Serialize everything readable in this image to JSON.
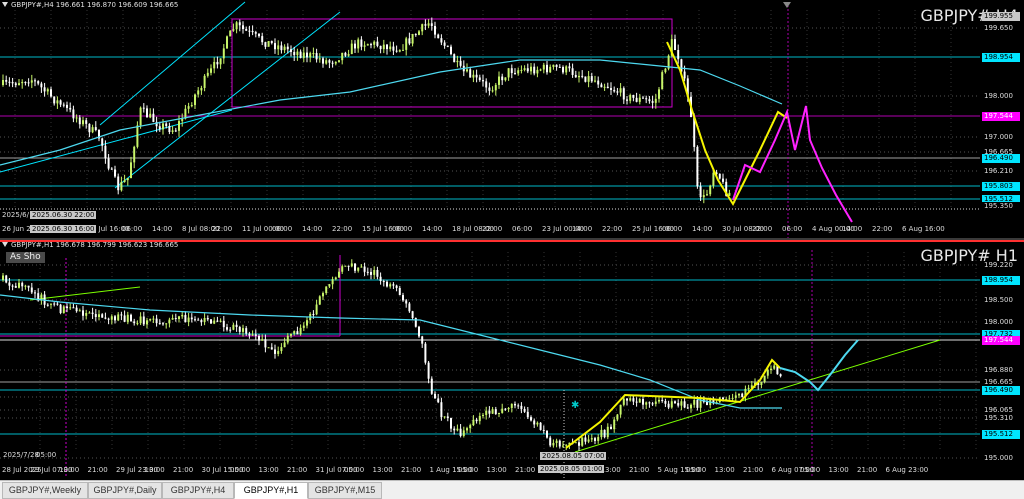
{
  "top": {
    "header": "GBPJPY#,H4  196.661 196.870 196.609 196.665",
    "watermark": "GBPJPY# H4",
    "price_labels": [
      {
        "text": "199.955",
        "style": "grey"
      },
      {
        "text": "199.650",
        "style": "plain"
      },
      {
        "text": "198.954",
        "style": "cyan"
      },
      {
        "text": "198.000",
        "style": "plain"
      },
      {
        "text": "197.544",
        "style": "mag"
      },
      {
        "text": "197.000",
        "style": "plain"
      },
      {
        "text": "196.665",
        "style": "plain"
      },
      {
        "text": "196.490",
        "style": "cyan"
      },
      {
        "text": "196.210",
        "style": "plain"
      },
      {
        "text": "195.803",
        "style": "cyan"
      },
      {
        "text": "195.512",
        "style": "cyan"
      },
      {
        "text": "195.350",
        "style": "plain"
      }
    ],
    "time_labels": [
      "26 Jun 2025",
      "14:00",
      "22:00",
      "3 Jul 16:00",
      "06:00",
      "14:00",
      "8 Jul 08:00",
      "22:00",
      "11 Jul 00:00",
      "06:00",
      "14:00",
      "22:00",
      "15 Jul 16:00",
      "06:00",
      "14:00",
      "18 Jul 08:00",
      "22:00",
      "06:00",
      "23 Jul 00:00",
      "14:00",
      "22:00",
      "25 Jul 16:00",
      "06:00",
      "14:00",
      "30 Jul 08:00",
      "22:00",
      "06:00",
      "4 Aug 00:00",
      "14:00",
      "22:00",
      "6 Aug 16:00"
    ],
    "cursor_time_left": "2025.06.30 22:00",
    "cursor_time_bottom": "2025.06.30 16:00",
    "left_edge_label": "2025/6/"
  },
  "bottom": {
    "header": "GBPJPY#,H1  196.678 196.799 196.623 196.665",
    "watermark": "GBPJPY# H1",
    "button": "As Sho",
    "price_labels": [
      {
        "text": "199.220",
        "style": "plain"
      },
      {
        "text": "198.954",
        "style": "cyan"
      },
      {
        "text": "198.500",
        "style": "plain"
      },
      {
        "text": "198.000",
        "style": "plain"
      },
      {
        "text": "197.732",
        "style": "cyan"
      },
      {
        "text": "197.544",
        "style": "mag"
      },
      {
        "text": "196.880",
        "style": "plain"
      },
      {
        "text": "196.665",
        "style": "plain"
      },
      {
        "text": "196.490",
        "style": "cyan"
      },
      {
        "text": "196.065",
        "style": "plain"
      },
      {
        "text": "195.310",
        "style": "plain"
      },
      {
        "text": "195.512",
        "style": "cyan"
      },
      {
        "text": "195.000",
        "style": "plain"
      }
    ],
    "time_labels": [
      "28 Jul 2025",
      "29 Jul 07:00",
      "13:00",
      "21:00",
      "29 Jul 23:00",
      "13:00",
      "21:00",
      "30 Jul 15:00",
      "05:00",
      "13:00",
      "21:00",
      "31 Jul 07:00",
      "05:00",
      "13:00",
      "21:00",
      "1 Aug 15:00",
      "05:00",
      "13:00",
      "21:00",
      "4 Aug 07:00",
      "21:00",
      "13:00",
      "21:00",
      "5 Aug 15:00",
      "05:00",
      "13:00",
      "21:00",
      "6 Aug 07:00",
      "05:00",
      "13:00",
      "21:00",
      "6 Aug 23:00"
    ],
    "cursor_time_left": "2025/7/28",
    "cursor_time_top": "2025.08.05 07:00",
    "cursor_time_bottom": "2025.08.05 01:00",
    "left_edge_time": "05:00"
  },
  "tabs": [
    {
      "label": "GBPJPY#,Weekly",
      "active": false
    },
    {
      "label": "GBPJPY#,Daily",
      "active": false
    },
    {
      "label": "GBPJPY#,H4",
      "active": false
    },
    {
      "label": "GBPJPY#,H1",
      "active": true
    },
    {
      "label": "GBPJPY#,M15",
      "active": false
    }
  ],
  "colors": {
    "background": "#000000",
    "bull": "#c8f56a",
    "bear": "#ffffff",
    "ma": "#4dd9f0",
    "trend": "#00e5ff",
    "box": "#cc00cc",
    "forecast_yellow": "#f5f500",
    "forecast_magenta": "#ff22ff",
    "trend_green": "#7cff00",
    "level_cyan": "#00b8c8",
    "red_line": "#ff3030"
  }
}
